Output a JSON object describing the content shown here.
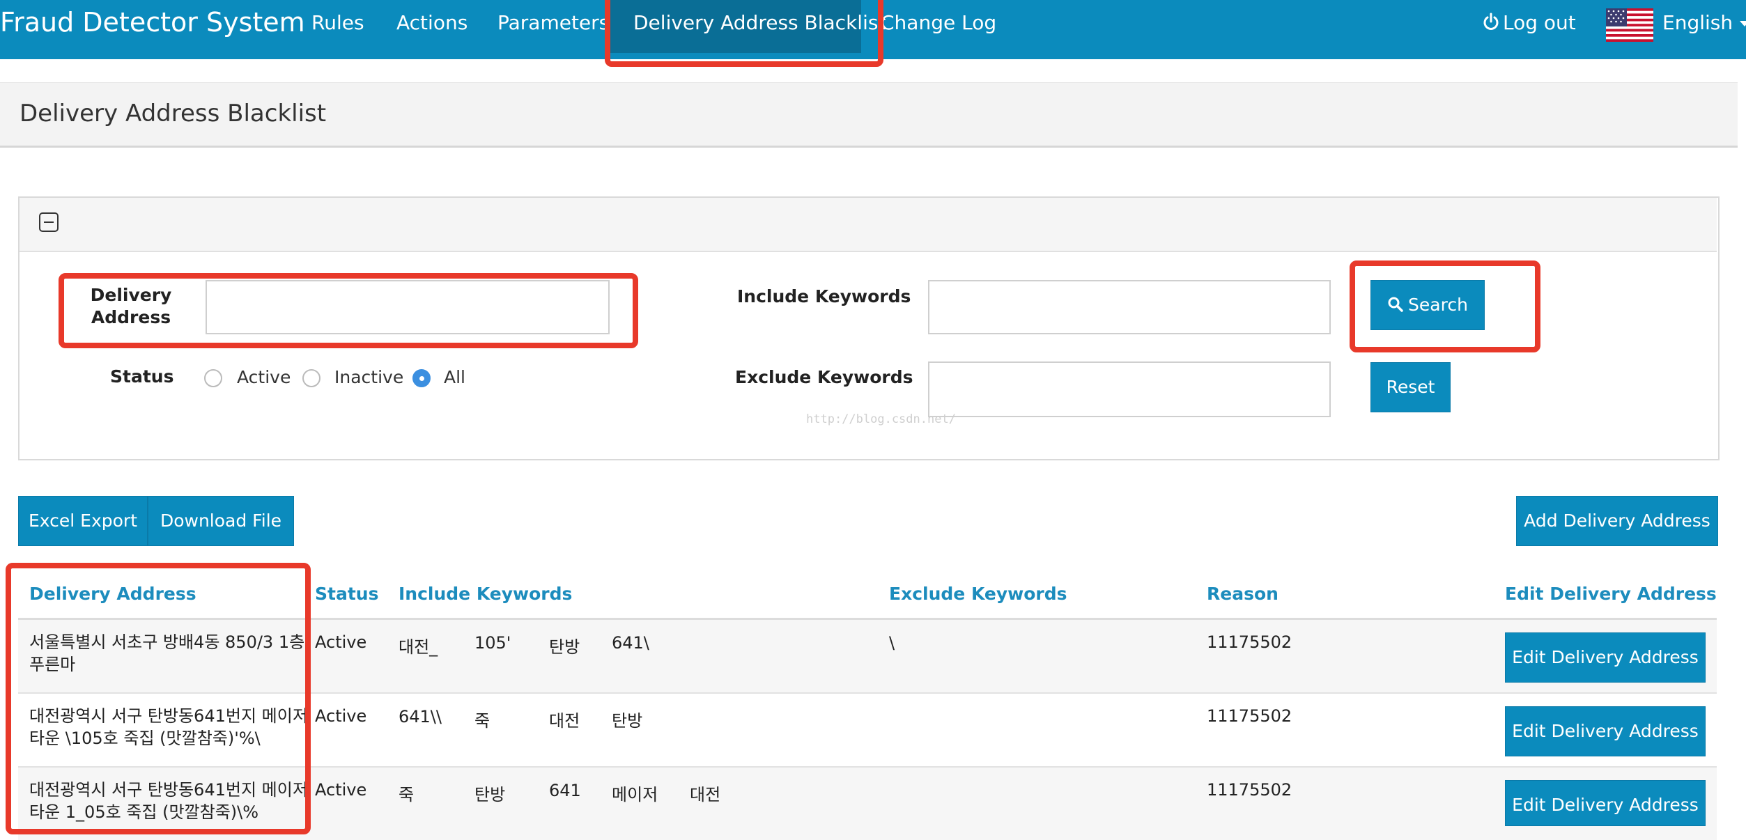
{
  "app": {
    "title": "Fraud Detector System",
    "nav": [
      "Rules",
      "Actions",
      "Parameters",
      "Delivery Address Blacklist",
      "Change Log"
    ],
    "logout": "Log out",
    "language": "English",
    "power_icon": "power-icon",
    "flag_icon": "us-flag-icon",
    "accent_color": "#0b8bbd",
    "highlight_color": "#e8392a"
  },
  "page": {
    "title": "Delivery Address Blacklist"
  },
  "search": {
    "delivery_address_label_1": "Delivery",
    "delivery_address_label_2": "Address",
    "delivery_address_value": "",
    "include_label": "Include Keywords",
    "include_value": "",
    "exclude_label": "Exclude Keywords",
    "exclude_value": "",
    "status_label": "Status",
    "status_options": [
      "Active",
      "Inactive",
      "All"
    ],
    "status_selected": "All",
    "search_button": "Search",
    "reset_button": "Reset"
  },
  "watermark": "http://blog.csdn.net/",
  "actions": {
    "excel_export": "Excel Export",
    "download_file": "Download File",
    "add_address": "Add Delivery Address"
  },
  "table": {
    "headers": [
      "Delivery Address",
      "Status",
      "Include Keywords",
      "Exclude Keywords",
      "Reason",
      "Edit Delivery Address"
    ],
    "rows": [
      {
        "address_1": "서울특별시 서초구 방배4동 850/3 1층",
        "address_2": "푸른마",
        "status": "Active",
        "include": [
          "대전_",
          "105'",
          "탄방",
          "641\\"
        ],
        "exclude": "\\",
        "reason": "11175502",
        "edit": "Edit Delivery Address"
      },
      {
        "address_1": "대전광역시 서구 탄방동641번지 메이저",
        "address_2": "타운 \\105호 죽집 (맛깔참죽)'%\\",
        "status": "Active",
        "include": [
          "641\\\\",
          "죽",
          "대전",
          "탄방"
        ],
        "exclude": "",
        "reason": "11175502",
        "edit": "Edit Delivery Address"
      },
      {
        "address_1": "대전광역시 서구 탄방동641번지 메이저",
        "address_2": "타운 1_05호 죽집 (맛깔참죽)\\%",
        "status": "Active",
        "include": [
          "죽",
          "탄방",
          "641",
          "메이저",
          "대전"
        ],
        "exclude": "",
        "reason": "11175502",
        "edit": "Edit Delivery Address"
      }
    ]
  }
}
